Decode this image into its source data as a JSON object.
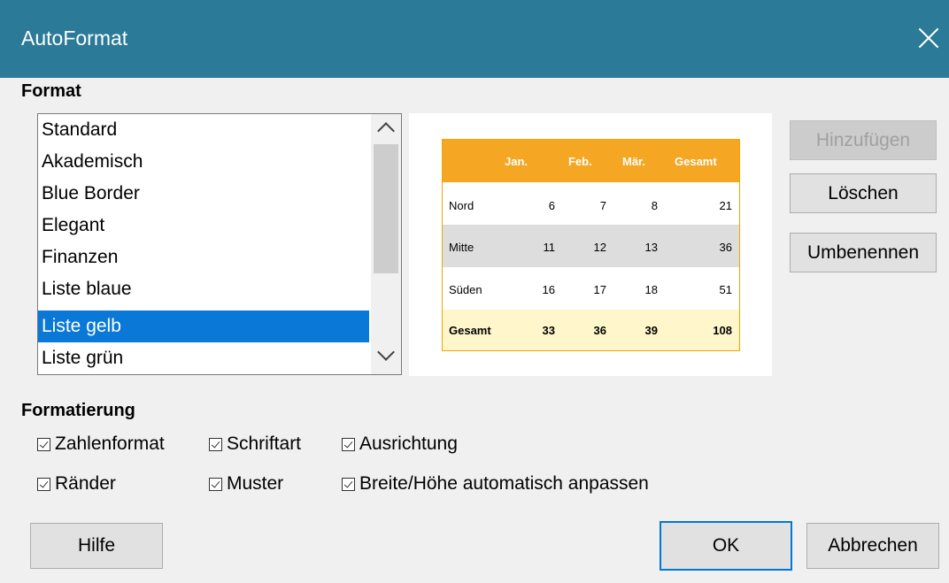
{
  "window": {
    "title": "AutoFormat"
  },
  "format_label": "Format",
  "format_list": {
    "items": [
      "Standard",
      "Akademisch",
      "Blue Border",
      "Elegant",
      "Finanzen",
      "Liste blaue",
      "Liste gelb",
      "Liste grün"
    ],
    "selected": "Liste gelb"
  },
  "preview": {
    "header": [
      "",
      "Jan.",
      "Feb.",
      "Mär.",
      "Gesamt"
    ],
    "rows": [
      [
        "Nord",
        "6",
        "7",
        "8",
        "21"
      ],
      [
        "Mitte",
        "11",
        "12",
        "13",
        "36"
      ],
      [
        "Süden",
        "16",
        "17",
        "18",
        "51"
      ],
      [
        "Gesamt",
        "33",
        "36",
        "39",
        "108"
      ]
    ],
    "colors": {
      "header_bg": "#f5a623",
      "band_bg": "#dddddd",
      "total_bg": "#fff6cc",
      "border": "#f0a500"
    }
  },
  "buttons": {
    "add": "Hinzufügen",
    "delete": "Löschen",
    "rename": "Umbenennen",
    "help": "Hilfe",
    "ok": "OK",
    "cancel": "Abbrechen"
  },
  "formatting_label": "Formatierung",
  "options": {
    "number_format": {
      "label": "Zahlenformat",
      "checked": true
    },
    "font": {
      "label": "Schriftart",
      "checked": true
    },
    "alignment": {
      "label": "Ausrichtung",
      "checked": true
    },
    "borders": {
      "label": "Ränder",
      "checked": true
    },
    "pattern": {
      "label": "Muster",
      "checked": true
    },
    "autofit": {
      "label": "Breite/Höhe automatisch anpassen",
      "checked": true
    }
  },
  "colors": {
    "titlebar": "#2b7a97",
    "selection": "#0a78d7",
    "accent": "#0078d7"
  }
}
